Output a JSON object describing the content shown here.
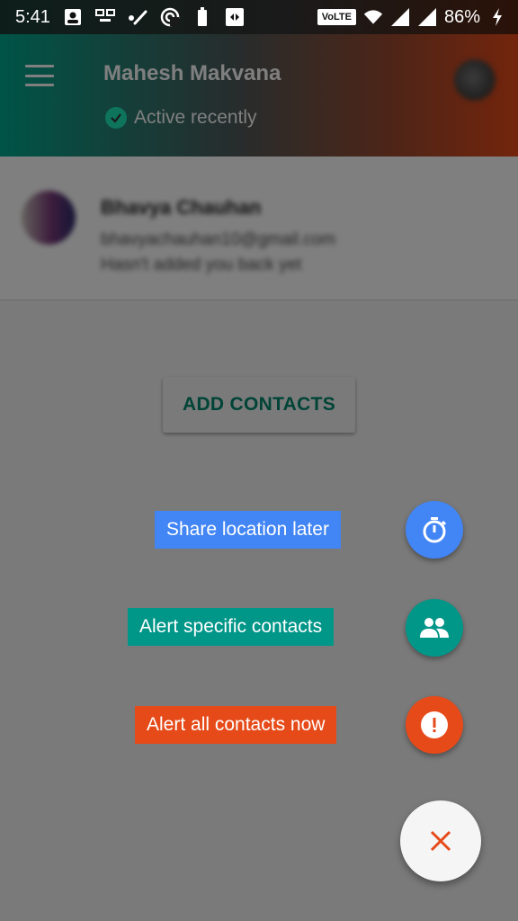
{
  "status_bar": {
    "time": "5:41",
    "left_icons": [
      "contact-card-icon",
      "network-icon",
      "check-stroke-icon",
      "location-sharing-icon",
      "battery-saver-icon",
      "app-icon"
    ],
    "volte": "VoLTE",
    "battery": "86%"
  },
  "app_bar": {
    "title": "Mahesh Makvana",
    "status": "Active recently"
  },
  "contact": {
    "name": "Bhavya Chauhan",
    "email": "bhavyachauhan10@gmail.com",
    "status": "Hasn't added you back yet"
  },
  "add_contacts_label": "ADD CONTACTS",
  "fab_menu": {
    "items": [
      {
        "label": "Share location later",
        "icon": "timer-icon",
        "color": "#4285f4"
      },
      {
        "label": "Alert specific contacts",
        "icon": "people-icon",
        "color": "#009688"
      },
      {
        "label": "Alert all contacts now",
        "icon": "alert-icon",
        "color": "#e64a19"
      }
    ],
    "close_color": "#e64a19"
  }
}
